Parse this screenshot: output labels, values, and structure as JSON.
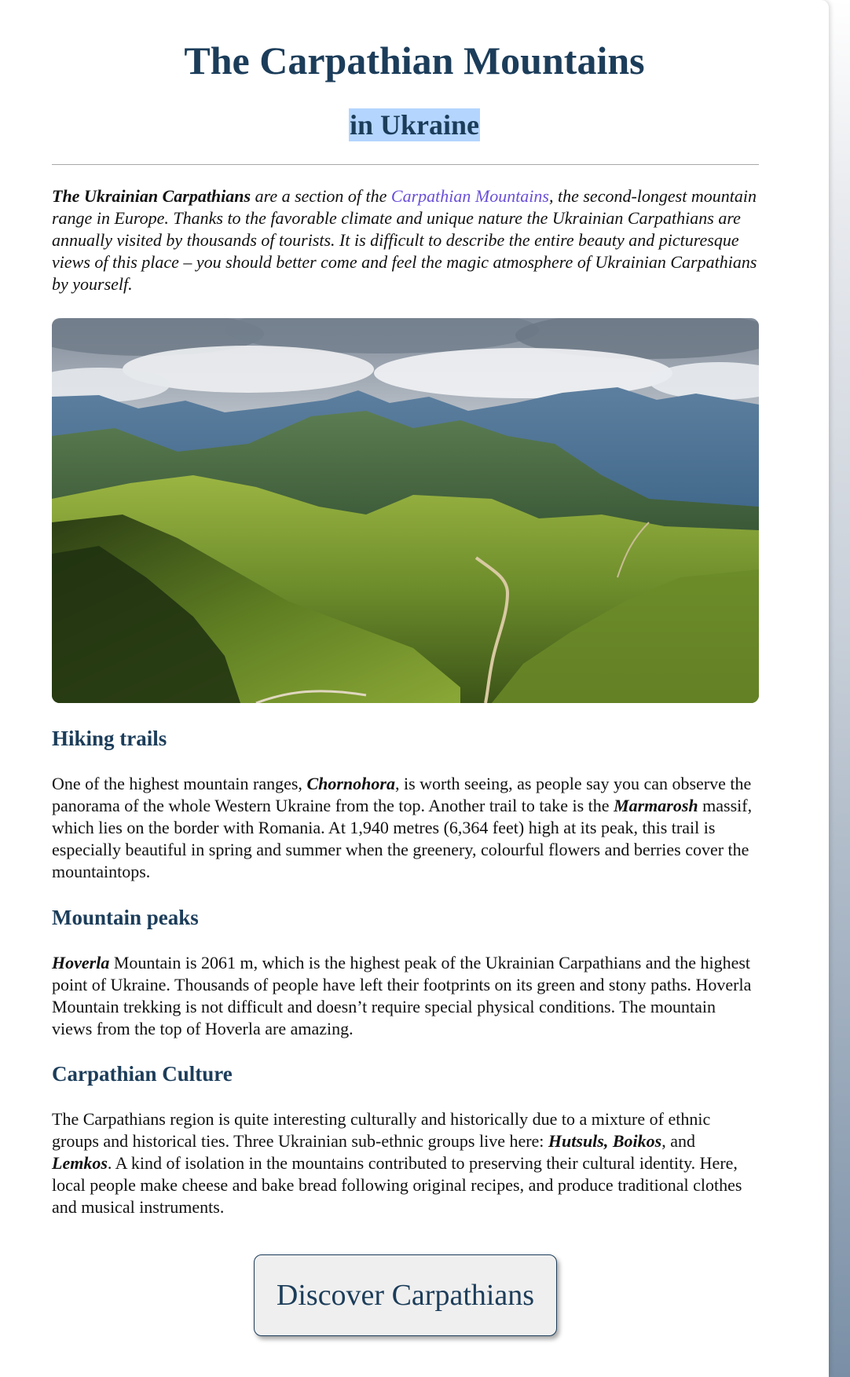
{
  "header": {
    "title": "The Carpathian Mountains",
    "subtitle": "in Ukraine"
  },
  "intro": {
    "lead_bold": "The Ukrainian Carpathians",
    "text_a": " are a section of the ",
    "link": "Carpathian Mountains",
    "text_b": ", the second-longest mountain range in Europe. Thanks to the favorable climate and unique nature the Ukrainian Carpathians are annually visited by thousands of tourists. It is difficult to describe the entire beauty and picturesque views of this place – you should better come and feel the magic atmosphere of Ukrainian Carpathians by yourself."
  },
  "sections": [
    {
      "heading": "Hiking trails",
      "p1": "One of the highest mountain ranges, ",
      "b1": "Chornohora",
      "p2": ", is worth seeing, as people say you can observe the panorama of the whole Western Ukraine from the top. Another trail to take is the ",
      "b2": "Marmarosh",
      "p3": " massif, which lies on the border with Romania. At 1,940 metres (6,364 feet) high at its peak, this trail is especially beautiful in spring and summer when the greenery, colourful flowers and berries cover the mountaintops."
    },
    {
      "heading": "Mountain peaks",
      "b1": "Hoverla",
      "p1": " Mountain is 2061 m, which is the highest peak of the Ukrainian Carpathians and the highest point of Ukraine. Thousands of people have left their footprints on its green and stony paths. Hoverla Mountain trekking is not difficult and doesn’t require special physical conditions. The mountain views from the top of Hoverla are amazing."
    },
    {
      "heading": "Carpathian Culture",
      "p1": "The Carpathians region is quite interesting culturally and historically due to a mixture of ethnic groups and historical ties. Three Ukrainian sub-ethnic groups live here: ",
      "b1": "Hutsuls,",
      "b1b": "Boikos",
      "p2": ", and ",
      "b2": "Lemkos",
      "p3": ". A kind of isolation in the mountains contributed to preserving their cultural identity. Here, local people make cheese and bake bread following original recipes, and produce traditional clothes and musical instruments."
    }
  ],
  "cta": {
    "label": "Discover Carpathians"
  },
  "colors": {
    "heading": "#1c3d5a",
    "link": "#6a4fd8",
    "highlight": "#b4d5fe"
  }
}
